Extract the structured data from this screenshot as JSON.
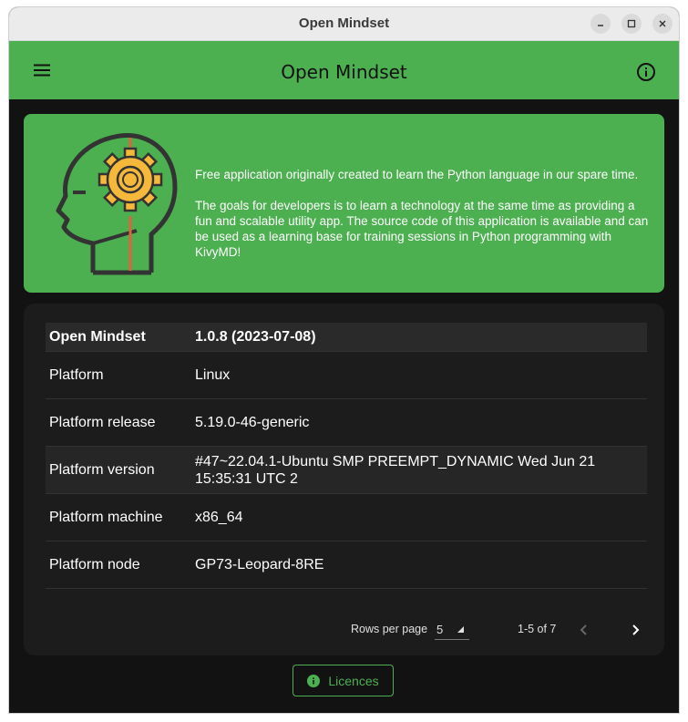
{
  "window": {
    "title": "Open Mindset",
    "controls": [
      "minimize-icon",
      "maximize-icon",
      "close-icon"
    ]
  },
  "appbar": {
    "title": "Open Mindset",
    "left_icon": "menu-icon",
    "right_icon": "info-icon",
    "color": "#4caf50"
  },
  "banner": {
    "logo_icon": "head-gear-icon",
    "paragraphs": [
      "Free application originally created to learn the Python language in our spare time.",
      "The goals for developers is to learn a technology at the same time as providing a fun and scalable utility app. The source code of this application is available and can be used as a learning base for training sessions in Python programming with KivyMD!"
    ]
  },
  "info_table": {
    "header": {
      "key": "Open Mindset",
      "value": "1.0.8 (2023-07-08)"
    },
    "rows": [
      {
        "key": "Platform",
        "value": "Linux"
      },
      {
        "key": "Platform release",
        "value": "5.19.0-46-generic"
      },
      {
        "key": "Platform version",
        "value": "#47~22.04.1-Ubuntu SMP PREEMPT_DYNAMIC Wed Jun 21 15:35:31 UTC 2"
      },
      {
        "key": "Platform machine",
        "value": "x86_64"
      },
      {
        "key": "Platform node",
        "value": "GP73-Leopard-8RE"
      }
    ]
  },
  "pagination": {
    "rows_per_page_label": "Rows per page",
    "rows_per_page_value": "5",
    "range_text": "1-5 of 7",
    "prev_icon": "chevron-left-icon",
    "next_icon": "chevron-right-icon"
  },
  "licences_button": {
    "label": "Licences",
    "icon": "info-circle-icon"
  }
}
